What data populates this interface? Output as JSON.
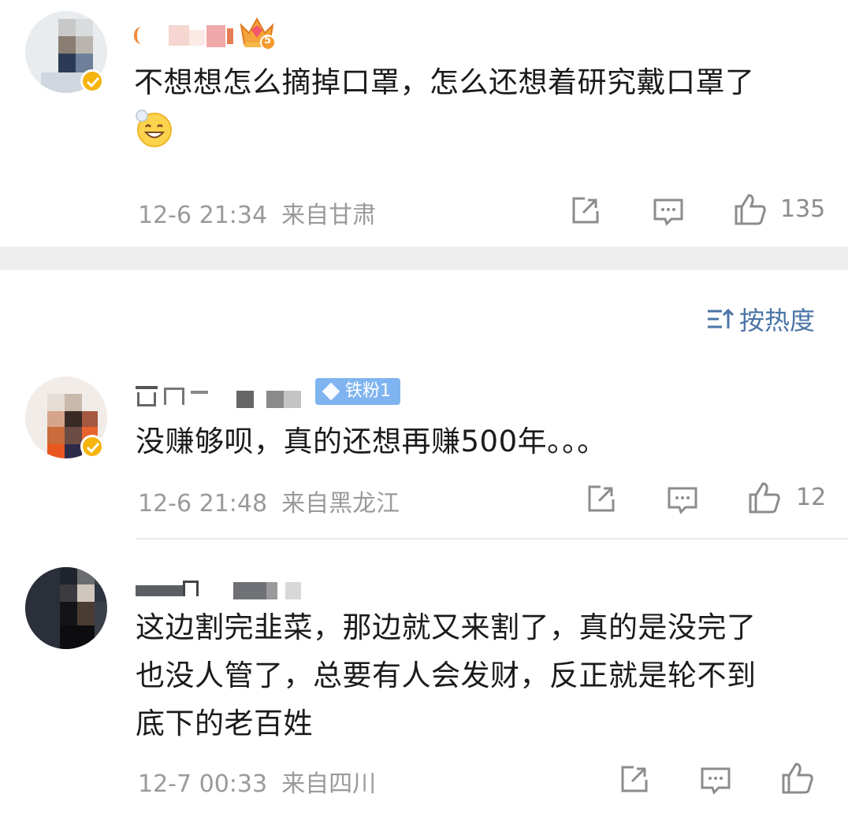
{
  "comments": [
    {
      "text_lines": [
        "不想想怎么摘掉口罩，怎么还想着研究戴口罩了"
      ],
      "time": "12-6 21:34",
      "location": "来自甘肃",
      "likes": "135",
      "icons": [
        "share-icon",
        "comment-icon",
        "like-icon"
      ],
      "badge_icon": "crown-level-icon",
      "badge_level": "5",
      "emoji": "grinning-emoji-icon"
    },
    {
      "text_lines": [
        "没赚够呗，真的还想再赚500年。。。"
      ],
      "time": "12-6 21:48",
      "location": "来自黑龙江",
      "likes": "12",
      "badge_label": "铁粉1"
    },
    {
      "text_lines": [
        "这边割完韭菜，那边就又来割了，真的是没完了",
        "也没人管了，总要有人会发财，反正就是轮不到",
        "底下的老百姓"
      ],
      "time": "12-7 00:33",
      "location": "来自四川",
      "likes": ""
    }
  ],
  "sort": {
    "label": "按热度",
    "icon": "sort-icon"
  },
  "colors": {
    "accent": "#4a74a6",
    "badge": "#7fb4f0",
    "verified": "#f6b40e",
    "meta": "#9a9a9a"
  }
}
